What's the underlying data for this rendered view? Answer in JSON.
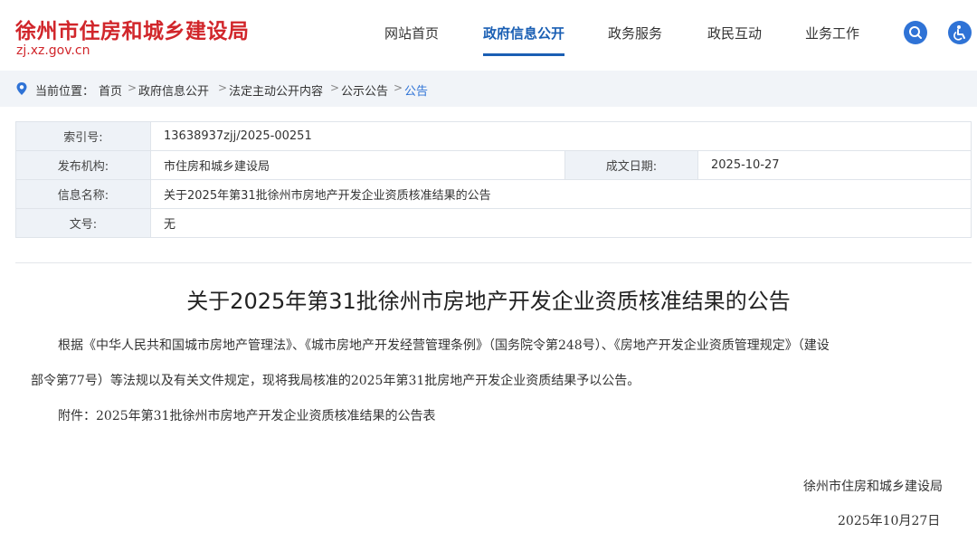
{
  "header": {
    "site_title": "徐州市住房和城乡建设局",
    "site_url": "zj.xz.gov.cn",
    "nav": [
      "网站首页",
      "政府信息公开",
      "政务服务",
      "政民互动",
      "业务工作"
    ],
    "nav_active": "政府信息公开",
    "icons": [
      "search-icon",
      "accessibility-icon"
    ],
    "accent_color": "#2f73d6",
    "brand_color": "#d1262b"
  },
  "breadcrumb": {
    "prefix": "当前位置：",
    "items": [
      "首页",
      "政府信息公开",
      "法定主动公开内容",
      "公示公告",
      "公告"
    ]
  },
  "info": {
    "index_label": "索引号:",
    "index_value": "13638937zjj/2025-00251",
    "org_label": "发布机构:",
    "org_value": "市住房和城乡建设局",
    "date_label": "成文日期:",
    "date_value": "2025-10-27",
    "name_label": "信息名称:",
    "name_value": "关于2025年第31批徐州市房地产开发企业资质核准结果的公告",
    "doc_label": "文号:",
    "doc_value": "无"
  },
  "article": {
    "title": "关于2025年第31批徐州市房地产开发企业资质核准结果的公告",
    "para1_line1": "根据《中华人民共和国城市房地产管理法》、《城市房地产开发经营管理条例》（国务院令第248号）、《房地产开发企业资质管理规定》（建设",
    "para1_line2": "部令第77号）等法规以及有关文件规定，现将我局核准的2025年第31批房地产开发企业资质结果予以公告。",
    "attachment": "附件：2025年第31批徐州市房地产开发企业资质核准结果的公告表",
    "signature": "徐州市住房和城乡建设局",
    "sign_date": "2025年10月27日"
  }
}
